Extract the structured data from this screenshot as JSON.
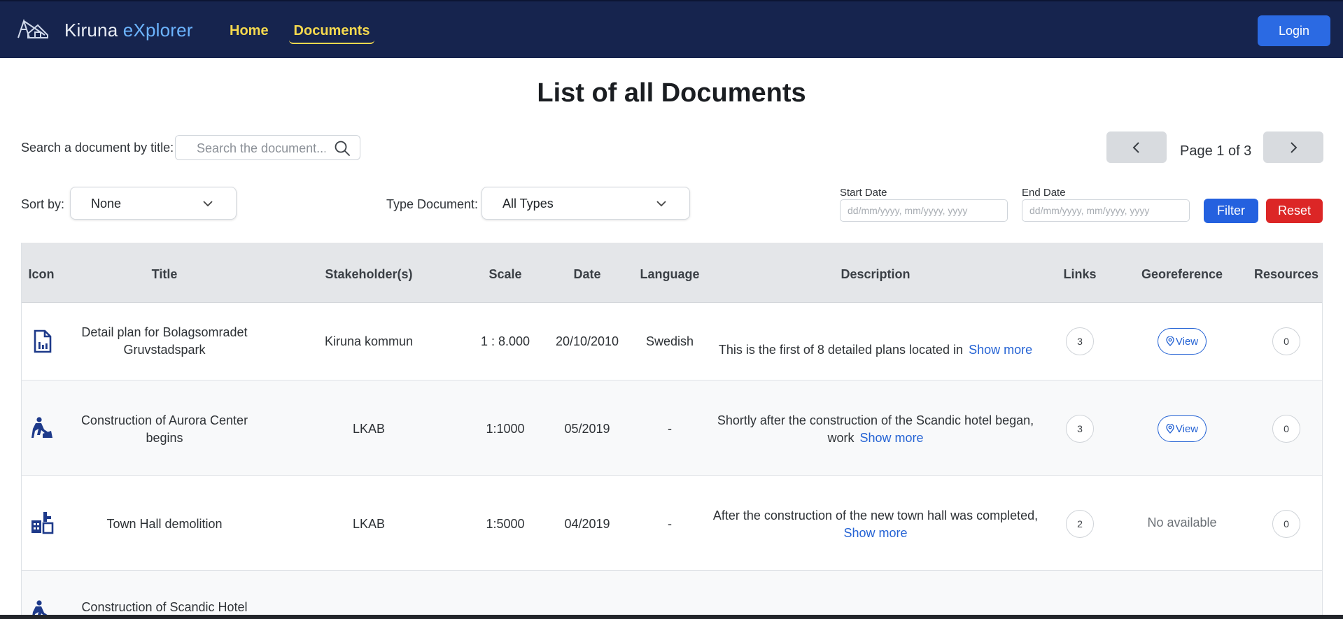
{
  "navbar": {
    "brand_main": "Kiruna ",
    "brand_accent": "eXplorer",
    "links": [
      "Home",
      "Documents"
    ],
    "login_label": "Login"
  },
  "page_title": "List of all Documents",
  "search": {
    "label": "Search a document by title:",
    "placeholder": "Search the document..."
  },
  "pager": {
    "indicator": "Page 1 of 3"
  },
  "filters": {
    "sort_label": "Sort by:",
    "sort_value": "None",
    "type_label": "Type Document:",
    "type_value": "All Types",
    "start_label": "Start Date",
    "end_label": "End Date",
    "date_placeholder": "dd/mm/yyyy, mm/yyyy, yyyy",
    "filter_label": "Filter",
    "reset_label": "Reset"
  },
  "table": {
    "headers": [
      "Icon",
      "Title",
      "Stakeholder(s)",
      "Scale",
      "Date",
      "Language",
      "Description",
      "Links",
      "Georeference",
      "Resources"
    ],
    "rows": [
      {
        "icon": "document-chart-icon",
        "title": "Detail plan for Bolagsomradet Gruvstadspark",
        "stakeholder": "Kiruna kommun",
        "scale": "1 : 8.000",
        "date": "20/10/2010",
        "language": "Swedish",
        "description": "This is the first of 8 detailed plans located in",
        "show_more": "Show more",
        "links": "3",
        "georef": "View",
        "resources": "0"
      },
      {
        "icon": "construction-worker-icon",
        "title": "Construction of Aurora Center begins",
        "stakeholder": "LKAB",
        "scale": "1:1000",
        "date": "05/2019",
        "language": "-",
        "description": "Shortly after the construction of the Scandic hotel began, work",
        "show_more": "Show more",
        "links": "3",
        "georef": "View",
        "resources": "0"
      },
      {
        "icon": "demolition-icon",
        "title": "Town Hall demolition",
        "stakeholder": "LKAB",
        "scale": "1:5000",
        "date": "04/2019",
        "language": "-",
        "description": "After the construction of the new town hall was completed,",
        "show_more": "Show more",
        "links": "2",
        "georef": "No available",
        "resources": "0"
      },
      {
        "icon": "construction-worker-icon",
        "title": "Construction of Scandic Hotel"
      }
    ]
  },
  "colors": {
    "navbar": "#16244e",
    "nav_active": "#f5d94e",
    "brand_accent": "#6cb4ff",
    "primary": "#2461df",
    "danger": "#dc2626",
    "icon": "#1e3a8a"
  }
}
